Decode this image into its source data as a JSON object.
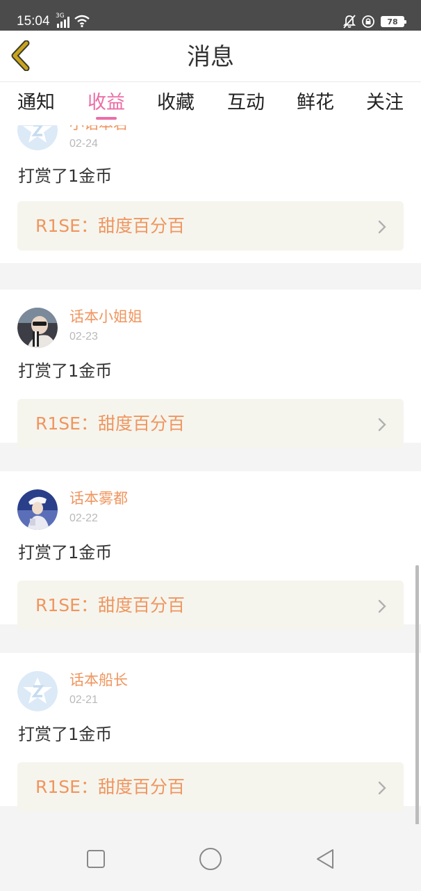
{
  "status_bar": {
    "time": "15:04",
    "network": "3G",
    "battery": "78",
    "icons": [
      "signal-icon",
      "wifi-icon",
      "mute-icon",
      "rotation-lock-icon",
      "battery-icon"
    ]
  },
  "header": {
    "title": "消息",
    "back_icon": "chevron-left-icon",
    "back_color": "#c9a51e"
  },
  "tabs": {
    "items": [
      {
        "label": "通知",
        "active": false
      },
      {
        "label": "收益",
        "active": true
      },
      {
        "label": "收藏",
        "active": false
      },
      {
        "label": "互动",
        "active": false
      },
      {
        "label": "鲜花",
        "active": false
      },
      {
        "label": "关注",
        "active": false
      }
    ],
    "active_color": "#ec6da6"
  },
  "feed": {
    "items": [
      {
        "user": "小话本君",
        "date": "02-24",
        "action": "打赏了1金币",
        "work": "R1SE：甜度百分百",
        "avatar": "default-avatar"
      },
      {
        "user": "话本小姐姐",
        "date": "02-23",
        "action": "打赏了1金币",
        "work": "R1SE：甜度百分百",
        "avatar": "photo-avatar"
      },
      {
        "user": "话本雾都",
        "date": "02-22",
        "action": "打赏了1金币",
        "work": "R1SE：甜度百分百",
        "avatar": "photo-avatar"
      },
      {
        "user": "话本船长",
        "date": "02-21",
        "action": "打赏了1金币",
        "work": "R1SE：甜度百分百",
        "avatar": "default-avatar"
      }
    ],
    "name_color": "#f0955e"
  },
  "nav_bar": {
    "buttons": [
      "recents-square-icon",
      "home-circle-icon",
      "back-triangle-icon"
    ]
  }
}
